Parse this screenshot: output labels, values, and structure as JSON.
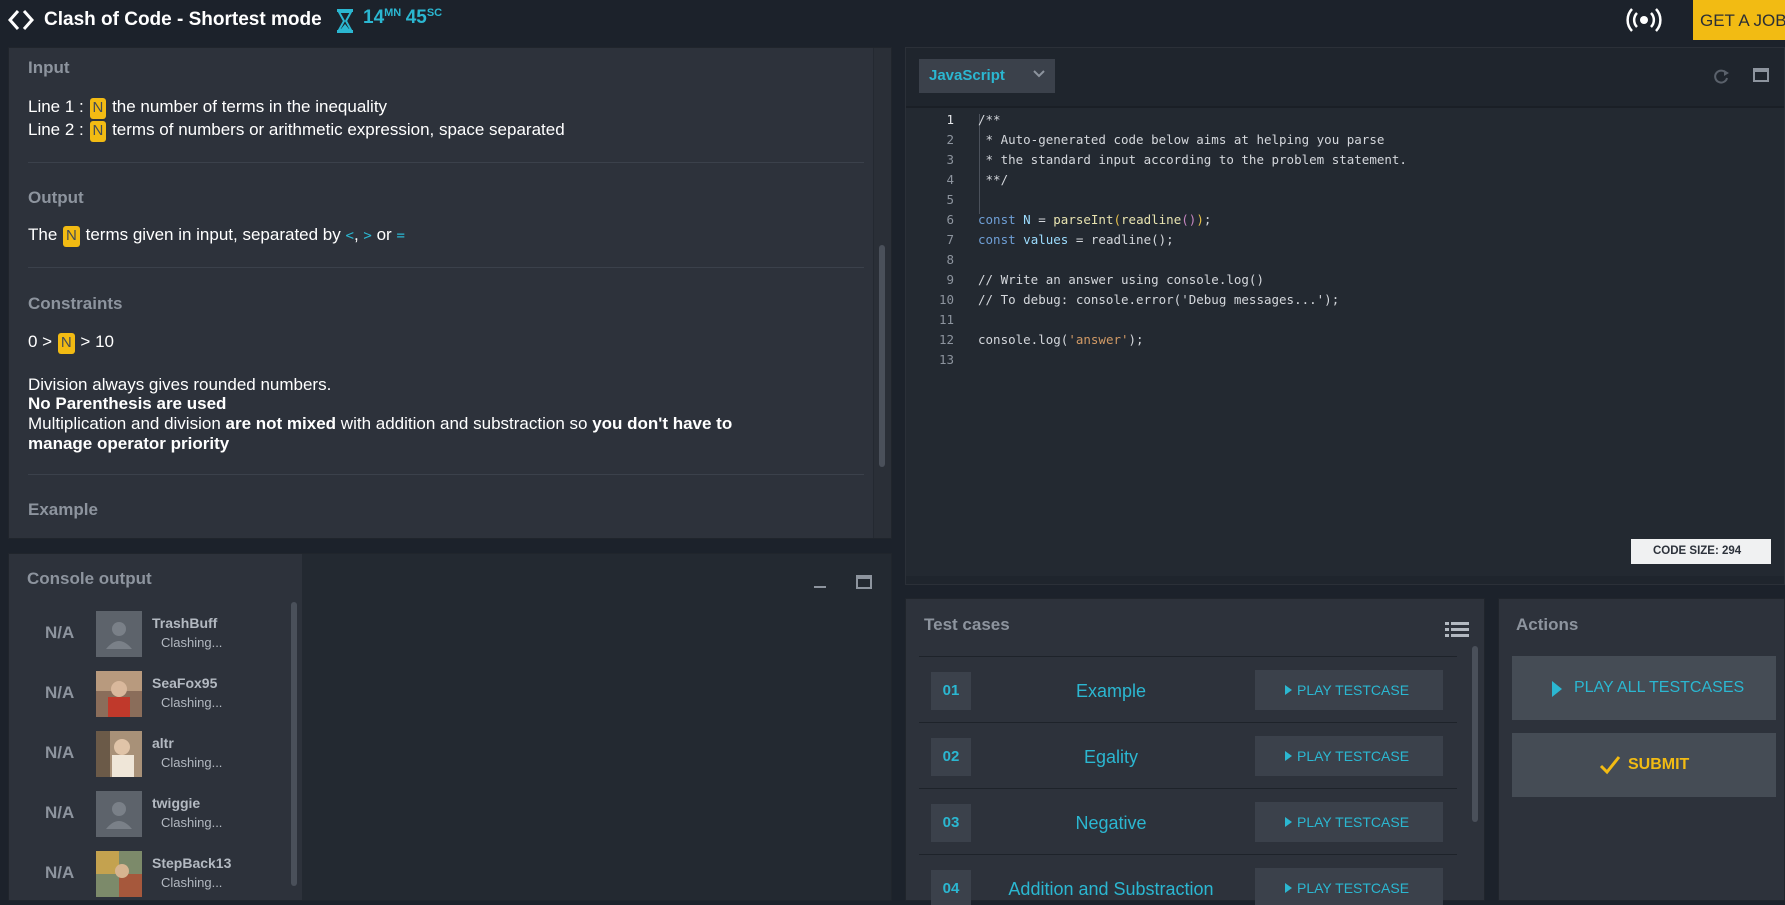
{
  "header": {
    "title": "Clash of Code - Shortest mode",
    "timer_minutes": "14",
    "timer_minutes_unit": "MN",
    "timer_seconds": "45",
    "timer_seconds_unit": "SC",
    "job_button": "GET A JOB"
  },
  "statement": {
    "input_title": "Input",
    "input_line1_prefix": "Line 1 :",
    "input_line1_var": "N",
    "input_line1_text": "the number of terms in the inequality",
    "input_line2_prefix": "Line 2 :",
    "input_line2_var": "N",
    "input_line2_text": "terms of numbers or arithmetic expression, space separated",
    "output_title": "Output",
    "output_prefix": "The",
    "output_var": "N",
    "output_text": "terms given in input, separated by",
    "output_op1": "<",
    "output_comma": ",",
    "output_op2": ">",
    "output_or": "or",
    "output_op3": "=",
    "constraints_title": "Constraints",
    "constraint_prefix": "0 >",
    "constraint_var": "N",
    "constraint_suffix": "> 10",
    "note1": "Division always gives rounded numbers.",
    "note2": "No Parenthesis are used",
    "note3_a": "Multiplication and division",
    "note3_b": "are not mixed",
    "note3_c": "with addition and substraction so",
    "note3_d": "you don't have to",
    "note3_e": "manage operator priority",
    "example_title": "Example"
  },
  "console": {
    "title": "Console output",
    "players": [
      {
        "score": "N/A",
        "name": "TrashBuff",
        "status": "Clashing..."
      },
      {
        "score": "N/A",
        "name": "SeaFox95",
        "status": "Clashing..."
      },
      {
        "score": "N/A",
        "name": "altr",
        "status": "Clashing..."
      },
      {
        "score": "N/A",
        "name": "twiggie",
        "status": "Clashing..."
      },
      {
        "score": "N/A",
        "name": "StepBack13",
        "status": "Clashing..."
      }
    ]
  },
  "editor": {
    "language": "JavaScript",
    "code_size_label": "CODE SIZE:",
    "code_size_value": "294",
    "line_numbers": [
      "1",
      "2",
      "3",
      "4",
      "5",
      "6",
      "7",
      "8",
      "9",
      "10",
      "11",
      "12",
      "13"
    ],
    "lines": {
      "l1": "/**",
      "l2": " * Auto-generated code below aims at helping you parse",
      "l3": " * the standard input according to the problem statement.",
      "l4": " **/",
      "l6_kw": "const",
      "l6_var": "N",
      "l6_eq": " = ",
      "l6_fn": "parseInt",
      "l6_p1": "(",
      "l6_fn2": "readline",
      "l6_p2": "()",
      "l6_p3": ")",
      "l6_end": ";",
      "l7_kw": "const",
      "l7_var": "values",
      "l7_rest": " = readline();",
      "l9": "// Write an answer using console.log()",
      "l10": "// To debug: console.error('Debug messages...');",
      "l12_a": "console.log(",
      "l12_str": "'answer'",
      "l12_b": ");"
    }
  },
  "tests": {
    "title": "Test cases",
    "play_label": "PLAY TESTCASE",
    "items": [
      {
        "num": "01",
        "name": "Example"
      },
      {
        "num": "02",
        "name": "Egality"
      },
      {
        "num": "03",
        "name": "Negative"
      },
      {
        "num": "04",
        "name": "Addition and Substraction"
      }
    ]
  },
  "actions": {
    "title": "Actions",
    "play_all": "PLAY ALL TESTCASES",
    "submit": "SUBMIT"
  },
  "colors": {
    "accent": "#2bb7d1",
    "highlight": "#f2bb13",
    "panel": "#2d323b",
    "background": "#1c222b"
  }
}
